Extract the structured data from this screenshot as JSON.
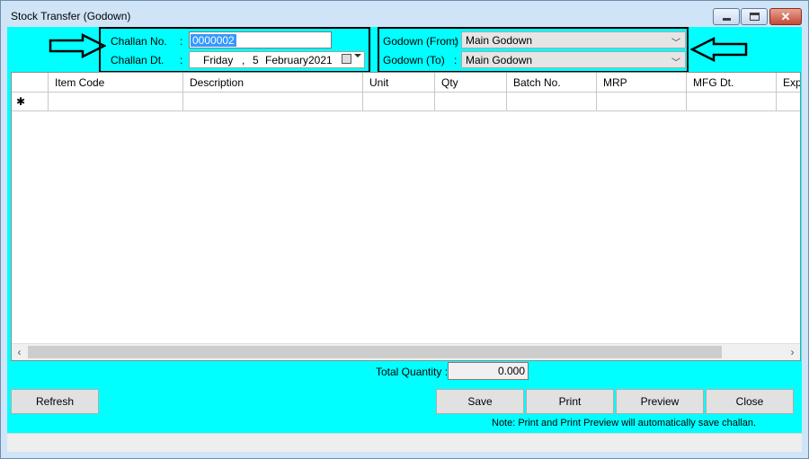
{
  "window": {
    "title": "Stock Transfer (Godown)",
    "controls": {
      "minimize": "minimize-icon",
      "maximize": "maximize-icon",
      "close": "close-icon",
      "close_glyph": "✕"
    }
  },
  "colors": {
    "client_bg": "#00ffff",
    "selection": "#3399ff",
    "close_button": "#c24a37"
  },
  "challan": {
    "no_label": "Challan No.",
    "no_value": "0000002",
    "dt_label": "Challan Dt.",
    "date": {
      "day_name": "Friday",
      "sep": ",",
      "day": "5",
      "month": "February",
      "year": "2021"
    }
  },
  "godown": {
    "from_label": "Godown (From)",
    "from_value": "Main Godown",
    "to_label": "Godown (To)",
    "to_value": "Main Godown",
    "chevron": "﹀"
  },
  "colon": ":",
  "grid": {
    "columns": [
      "",
      "Item Code",
      "Description",
      "Unit",
      "Qty",
      "Batch No.",
      "MRP",
      "MFG Dt.",
      "Exp"
    ],
    "new_row_marker": "✱",
    "scroll_left": "‹",
    "scroll_right": "›"
  },
  "total": {
    "label": "Total Quantity :",
    "value": "0.000"
  },
  "buttons": {
    "refresh": "Refresh",
    "save": "Save",
    "print": "Print",
    "preview": "Preview",
    "close": "Close"
  },
  "note": "Note: Print and Print Preview will automatically save challan."
}
